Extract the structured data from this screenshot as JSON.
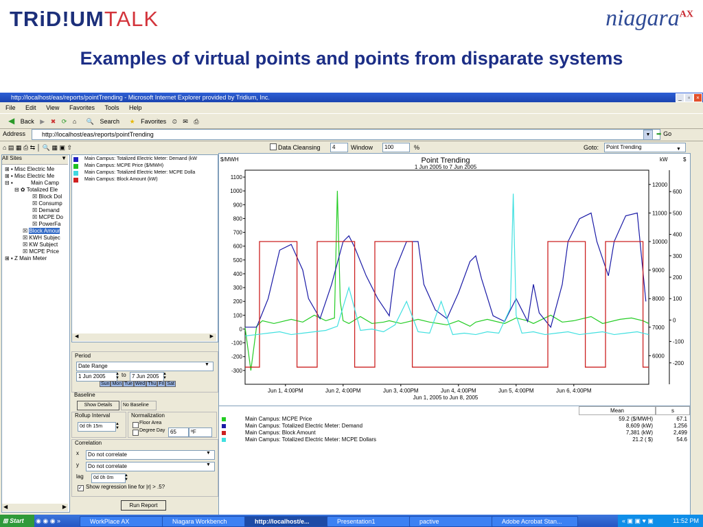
{
  "slide": {
    "logo_left_a": "TRiD!UM",
    "logo_left_b": "TALK",
    "logo_right": "niagara",
    "logo_right_sup": "AX",
    "title": "Examples of virtual points and points from disparate systems"
  },
  "window": {
    "title": "http://localhost/eas/reports/pointTrending - Microsoft Internet Explorer provided by Tridium, Inc.",
    "menu": [
      "File",
      "Edit",
      "View",
      "Favorites",
      "Tools",
      "Help"
    ],
    "toolbar": {
      "back": "Back",
      "search": "Search",
      "favorites": "Favorites"
    },
    "address_label": "Address",
    "address_value": "http://localhost/eas/reports/pointTrending",
    "go_label": "Go"
  },
  "appbar": {
    "data_cleansing_label": "Data Cleansing",
    "data_cleansing_value": "4",
    "window_label": "Window",
    "window_value": "100",
    "percent": "%",
    "goto_label": "Goto:",
    "goto_value": "Point Trending"
  },
  "tree": {
    "root": "All Sites",
    "items": [
      "Misc Electric Me",
      "Misc Electric Me",
      "Main Camp",
      "Totalized Ele",
      "Block Dol",
      "Consump",
      "Demand",
      "MCPE Do",
      "PowerFa",
      "Block Amour",
      "KWH Subjec",
      "KW Subject",
      "MCPE Price",
      "Z Main Meter"
    ]
  },
  "legend_top": [
    {
      "label": "Main Campus: Totalized Electric Meter: Demand (kW",
      "color": "#2020c0"
    },
    {
      "label": "Main Campus: MCPE Price ($/MWH)",
      "color": "#20c020"
    },
    {
      "label": "Main Campus: Totalized Electric Meter: MCPE Dolla",
      "color": "#40d8e0"
    },
    {
      "label": "Main Campus: Block Amount (kW)",
      "color": "#d02020"
    }
  ],
  "period": {
    "label": "Period",
    "range": "Date Range",
    "from": "1 Jun  2005",
    "to_label": "to",
    "to": "7 Jun  2005",
    "days": [
      "Sun",
      "Mon",
      "Tue",
      "Wed",
      "Thu",
      "Fri",
      "Sat"
    ]
  },
  "baseline": {
    "label": "Baseline",
    "show_details": "Show Details",
    "value": "No Baseline"
  },
  "rollup": {
    "label": "Rollup Interval",
    "value": "0d  0h 15m"
  },
  "normalization": {
    "label": "Normalization",
    "floor_area": "Floor Area",
    "degree_day": "Degree Day",
    "degree_value": "65",
    "unit": "ºF"
  },
  "correlation": {
    "label": "Correlation",
    "x_label": "x",
    "x_value": "Do not correlate",
    "y_label": "y",
    "y_value": "Do not correlate",
    "lag_label": "lag",
    "lag_value": "0d  0h  0m",
    "regression": "Show regression line for |r| > .5?"
  },
  "run_report": "Run Report",
  "chart_data": {
    "type": "line",
    "title": "Point Trending",
    "subtitle": "1 Jun 2005 to 7 Jun 2005",
    "xlabel": "Jun 1, 2005 to Jun 8, 2005",
    "x_ticks": [
      "Jun 1, 4:00PM",
      "Jun 2, 4:00PM",
      "Jun 3, 4:00PM",
      "Jun 4, 4:00PM",
      "Jun 5, 4:00PM",
      "Jun 6, 4:00PM"
    ],
    "y_left_label": "$/MWH",
    "y_left_ticks": [
      "1100",
      "1000",
      "900",
      "800",
      "700",
      "600",
      "500",
      "400",
      "300",
      "200",
      "100",
      "0",
      "-100",
      "-200",
      "-300"
    ],
    "ylim_left": [
      -400,
      1150
    ],
    "y_right1_label": "kW",
    "y_right1_ticks": [
      "12000",
      "11000",
      "10000",
      "9000",
      "8000",
      "7000",
      "6000"
    ],
    "ylim_right1": [
      5000,
      12500
    ],
    "y_right2_label": "$",
    "y_right2_ticks": [
      "600",
      "500",
      "400",
      "300",
      "200",
      "100",
      "0",
      "-100",
      "-200"
    ],
    "ylim_right2": [
      -300,
      700
    ],
    "xlim_days": [
      0,
      7
    ],
    "series": [
      {
        "name": "Main Campus: MCPE Price",
        "color": "#22cc22",
        "axis": "left",
        "x": [
          0,
          0.1,
          0.2,
          0.3,
          0.5,
          0.8,
          1.0,
          1.2,
          1.4,
          1.55,
          1.6,
          1.65,
          1.7,
          1.8,
          2.0,
          2.2,
          2.4,
          2.5,
          2.7,
          3.0,
          3.2,
          3.5,
          3.7,
          3.9,
          4.0,
          4.2,
          4.5,
          4.7,
          4.9,
          5.0,
          5.3,
          5.5,
          5.7,
          6.0,
          6.2,
          6.5,
          6.7,
          6.9,
          7.0
        ],
        "y": [
          10,
          -300,
          20,
          60,
          40,
          70,
          50,
          100,
          60,
          80,
          1000,
          200,
          60,
          40,
          90,
          40,
          50,
          60,
          40,
          70,
          50,
          30,
          60,
          20,
          50,
          70,
          40,
          80,
          60,
          40,
          100,
          50,
          60,
          90,
          40,
          70,
          80,
          60,
          40
        ]
      },
      {
        "name": "Main Campus: Totalized Electric Meter: Demand",
        "color": "#1a1aa6",
        "axis": "right1",
        "x": [
          0,
          0.2,
          0.4,
          0.6,
          0.8,
          1.0,
          1.1,
          1.3,
          1.5,
          1.7,
          1.8,
          1.9,
          2.1,
          2.3,
          2.5,
          2.6,
          2.8,
          3.0,
          3.1,
          3.3,
          3.5,
          3.7,
          3.9,
          4.0,
          4.1,
          4.3,
          4.5,
          4.7,
          4.9,
          5.0,
          5.1,
          5.3,
          5.5,
          5.6,
          5.8,
          6.0,
          6.1,
          6.3,
          6.4,
          6.6,
          6.8,
          6.95
        ],
        "y": [
          7000,
          7000,
          8000,
          9700,
          9900,
          9000,
          8000,
          7300,
          8500,
          10000,
          10200,
          9800,
          8800,
          8000,
          7400,
          9000,
          10000,
          10000,
          8500,
          7600,
          7300,
          8200,
          9300,
          9500,
          8700,
          7400,
          7200,
          8000,
          7200,
          8500,
          7500,
          7000,
          8500,
          10000,
          10800,
          11000,
          10000,
          8800,
          10000,
          10900,
          11000,
          7900
        ]
      },
      {
        "name": "Main Campus: Block Amount",
        "color": "#cc2020",
        "axis": "right1",
        "blocks": [
          [
            0.25,
            0.9
          ],
          [
            1.25,
            1.9
          ],
          [
            2.25,
            2.9
          ],
          [
            5.25,
            5.9
          ],
          [
            6.25,
            6.9
          ]
        ],
        "high": 10000,
        "low": 5600
      },
      {
        "name": "Main Campus: Totalized Electric Meter: MCPE Dollars",
        "color": "#40e0e0",
        "axis": "left",
        "x": [
          0,
          0.2,
          0.4,
          0.6,
          0.8,
          1.0,
          1.2,
          1.4,
          1.6,
          1.8,
          2.0,
          2.2,
          2.4,
          2.6,
          2.8,
          3.0,
          3.2,
          3.4,
          3.6,
          3.8,
          4.0,
          4.2,
          4.4,
          4.6,
          4.65,
          4.7,
          4.8,
          5.0,
          5.2,
          5.4,
          5.6,
          5.8,
          6.0,
          6.2,
          6.4,
          6.6,
          6.8,
          7.0
        ],
        "y": [
          -50,
          -40,
          -30,
          -20,
          -40,
          -30,
          -20,
          -10,
          20,
          300,
          -10,
          0,
          -20,
          30,
          200,
          -20,
          -30,
          200,
          -40,
          -30,
          -40,
          -20,
          -30,
          150,
          980,
          100,
          -30,
          -20,
          -40,
          -30,
          -20,
          -40,
          -30,
          -20,
          -40,
          -30,
          -20,
          -40
        ]
      }
    ]
  },
  "mean_table": {
    "headers": [
      "Mean",
      "s"
    ],
    "rows": [
      {
        "color": "#22cc22",
        "name": "Main Campus: MCPE Price",
        "mean": "59.2 ($/MWH)",
        "s": "67.1"
      },
      {
        "color": "#1a1aa6",
        "name": "Main Campus: Totalized Electric Meter: Demand",
        "mean": "8,609 (kW)",
        "s": "1,256"
      },
      {
        "color": "#cc2020",
        "name": "Main Campus: Block Amount",
        "mean": "7,381 (kW)",
        "s": "2,499"
      },
      {
        "color": "#40e0e0",
        "name": "Main Campus: Totalized Electric Meter: MCPE Dollars",
        "mean": "21.2 ( $)",
        "s": "54.6"
      }
    ]
  },
  "taskbar": {
    "start": "Start",
    "tasks": [
      "WorkPlace AX",
      "Niagara Workbench",
      "http://localhost/e...",
      "Presentation1",
      "pactive",
      "Adobe Acrobat Stan..."
    ],
    "clock": "11:52 PM"
  }
}
